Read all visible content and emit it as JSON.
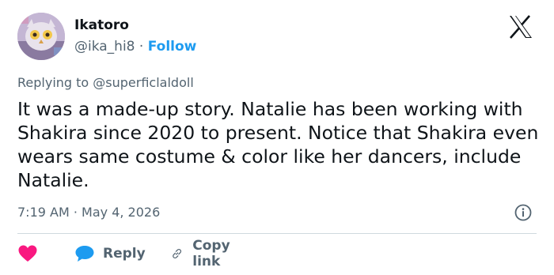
{
  "author": {
    "name": "Ikatoro",
    "handle": "@ika_hi8",
    "separator": "·",
    "follow_label": "Follow"
  },
  "platform_icon": "x-logo-icon",
  "reply_context": {
    "prefix": "Replying to",
    "mention": "@superficlaldoll"
  },
  "tweet": {
    "text": "It was a made-up story. Natalie has been working with Shakira since 2020 to present. Notice that Shakira even wears same costume & color like her dancers, include Natalie.",
    "timestamp": "7:19 AM · May 4, 2026"
  },
  "actions": {
    "like_icon": "heart-icon",
    "reply_label": "Reply",
    "copy_label": "Copy link"
  },
  "colors": {
    "accent": "#1d9bf0",
    "like": "#f91880",
    "text": "#0f1419",
    "muted": "#536471"
  }
}
